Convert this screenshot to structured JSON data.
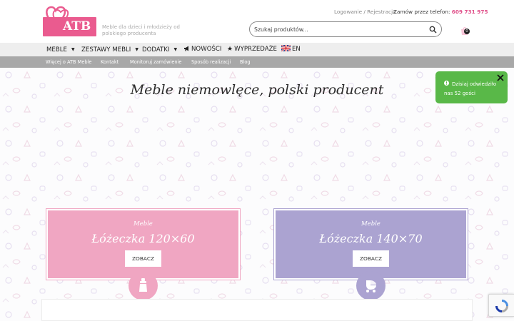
{
  "header": {
    "logo_text": "ATB",
    "tagline": "Meble dla dzieci i młodzieży od polskiego producenta",
    "account_links": "Logowanie / Rejestracja",
    "phone_label": "Zamów przez telefon:",
    "phone_number": "609 731 975",
    "search_placeholder": "Szukaj produktów...",
    "cart_count": "0"
  },
  "nav": {
    "items": [
      {
        "label": "MEBLE",
        "dropdown": true
      },
      {
        "label": "ZESTAWY MEBLI",
        "dropdown": true
      },
      {
        "label": "DODATKI",
        "dropdown": true
      },
      {
        "label": "NOWOŚCI",
        "icon": "megaphone-icon"
      },
      {
        "label": "WYPRZEDAŻE",
        "icon": "star-icon"
      },
      {
        "label": "EN",
        "icon": "uk-flag-icon"
      }
    ]
  },
  "subnav": {
    "items": [
      "Więcej o ATB Meble",
      "Kontakt",
      "Monitoruj zamówienie",
      "Sposób realizacji",
      "Blog"
    ]
  },
  "hero": {
    "title": "Meble niemowlęce, polski producent"
  },
  "promos": [
    {
      "subtitle": "Meble",
      "title": "Łóżeczka 120×60",
      "button": "ZOBACZ",
      "color": "#f0a6c2",
      "icon": "baby-bottle-icon"
    },
    {
      "subtitle": "Meble",
      "title": "Łóżeczka 140×70",
      "button": "ZOBACZ",
      "color": "#aba3d1",
      "icon": "stroller-icon"
    }
  ],
  "toast": {
    "text": "Dzisiaj odwiedziło nas 52 gości",
    "color": "#59b848"
  },
  "colors": {
    "brand_pink": "#ea5b8f",
    "nav_bg": "#eeeeee",
    "subnav_bg": "#a8a8a8"
  }
}
